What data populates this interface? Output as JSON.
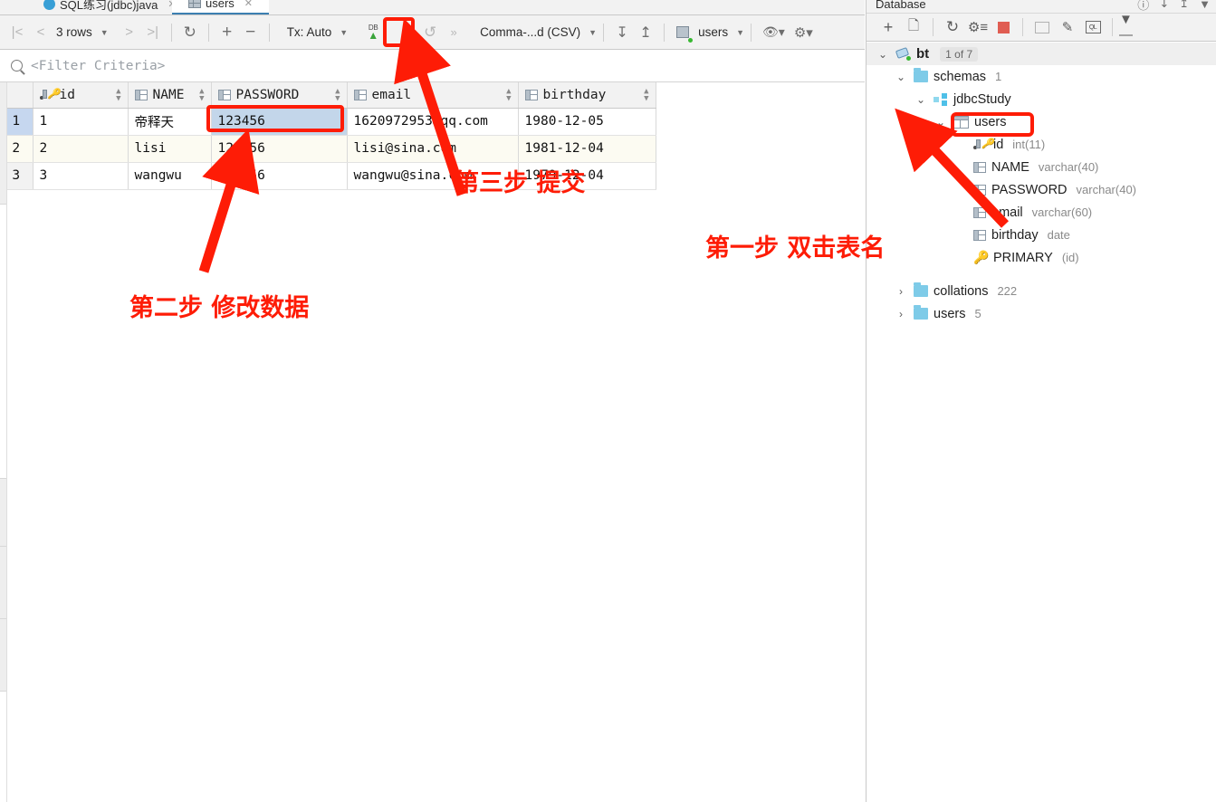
{
  "tabs": [
    {
      "label": "SQL练习(jdbc)java",
      "icon": "java-file-icon",
      "active": false
    },
    {
      "label": "users",
      "icon": "table-icon",
      "active": true
    }
  ],
  "toolbar": {
    "first_page": "|<",
    "prev_page": "<",
    "rows_label": "3 rows",
    "next_page": ">",
    "last_page": ">|",
    "reload": "reload-icon",
    "add_row": "+",
    "delete_row": "−",
    "tx_label": "Tx: Auto",
    "commit_label": "DB",
    "commit_arrow": "↑",
    "approve": "✓",
    "rollback": "↺",
    "more": "»",
    "format_label": "Comma-...d (CSV)",
    "import_icon": "download-icon",
    "export_icon": "upload-icon",
    "datasource_label": "users",
    "preview_icon": "eye-icon",
    "settings_icon": "gear-icon"
  },
  "filter": {
    "icon": "search-icon",
    "placeholder": "<Filter Criteria>"
  },
  "table": {
    "columns": [
      {
        "name": "id",
        "icon": "primary-key-icon"
      },
      {
        "name": "NAME",
        "icon": "column-icon"
      },
      {
        "name": "PASSWORD",
        "icon": "column-icon"
      },
      {
        "name": "email",
        "icon": "column-icon"
      },
      {
        "name": "birthday",
        "icon": "column-icon"
      }
    ],
    "rows": [
      {
        "num": "1",
        "id": "1",
        "name": "帝释天",
        "password": "123456",
        "email": "1620972953@qq.com",
        "birthday": "1980-12-05"
      },
      {
        "num": "2",
        "id": "2",
        "name": "lisi",
        "password": "123456",
        "email": "lisi@sina.com",
        "birthday": "1981-12-04"
      },
      {
        "num": "3",
        "id": "3",
        "name": "wangwu",
        "password": "123456",
        "email": "wangwu@sina.com",
        "birthday": "1979-12-04"
      }
    ]
  },
  "right_panel": {
    "title": "Database",
    "toolbar": {
      "add": "+",
      "copy": "copy-icon",
      "refresh": "refresh-icon",
      "sync": "sync-icon",
      "stop": "stop-icon",
      "table_view": "table-icon",
      "edit": "edit-icon",
      "query": "QL",
      "filter": "filter-icon"
    },
    "tree": [
      {
        "depth": 0,
        "twisty": "⌄",
        "icon": "connection-icon",
        "label": "bt",
        "badge": "1 of 7",
        "meta": "",
        "bold": true,
        "selected": true
      },
      {
        "depth": 1,
        "twisty": "⌄",
        "icon": "folder-icon",
        "label": "schemas",
        "meta": "1",
        "bold": false,
        "selected": false
      },
      {
        "depth": 2,
        "twisty": "⌄",
        "icon": "schema-icon",
        "label": "jdbcStudy",
        "meta": "",
        "bold": false,
        "selected": false
      },
      {
        "depth": 3,
        "twisty": "⌄",
        "icon": "table-icon",
        "label": "users",
        "meta": "",
        "bold": false,
        "selected": false
      },
      {
        "depth": 4,
        "twisty": "",
        "icon": "primary-key-icon",
        "label": "id",
        "meta": "int(11)",
        "bold": false,
        "selected": false
      },
      {
        "depth": 4,
        "twisty": "",
        "icon": "column-icon",
        "label": "NAME",
        "meta": "varchar(40)",
        "bold": false,
        "selected": false
      },
      {
        "depth": 4,
        "twisty": "",
        "icon": "column-icon",
        "label": "PASSWORD",
        "meta": "varchar(40)",
        "bold": false,
        "selected": false
      },
      {
        "depth": 4,
        "twisty": "",
        "icon": "column-icon",
        "label": "email",
        "meta": "varchar(60)",
        "bold": false,
        "selected": false
      },
      {
        "depth": 4,
        "twisty": "",
        "icon": "column-icon",
        "label": "birthday",
        "meta": "date",
        "bold": false,
        "selected": false
      },
      {
        "depth": 4,
        "twisty": "",
        "icon": "key-icon",
        "label": "PRIMARY",
        "meta": "(id)",
        "bold": false,
        "selected": false
      },
      {
        "depth": 1,
        "twisty": "›",
        "icon": "folder-icon",
        "label": "collations",
        "meta": "222",
        "bold": false,
        "selected": false
      },
      {
        "depth": 1,
        "twisty": "›",
        "icon": "folder-icon",
        "label": "users",
        "meta": "5",
        "bold": false,
        "selected": false
      }
    ]
  },
  "annotations": {
    "color": "#fe1c06",
    "step1": "第一步 双击表名",
    "step2": "第二步 修改数据",
    "step3": "第三步 提交"
  }
}
